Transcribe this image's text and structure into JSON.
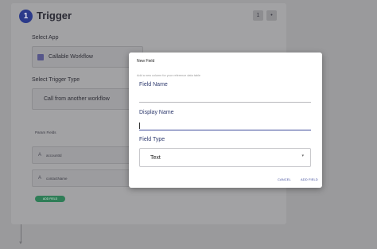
{
  "background": {
    "step_number": "1",
    "title": "Trigger",
    "mini_buttons": [
      "1",
      "•"
    ],
    "select_app_label": "Select App",
    "app_value": "Callable Workflow",
    "select_trigger_label": "Select Trigger Type",
    "trigger_value": "Call from another workflow",
    "param_fields_label": "Param Fields",
    "params": [
      {
        "icon": "A",
        "name": "accountId"
      },
      {
        "icon": "A",
        "name": "contactName"
      }
    ],
    "add_field_label": "ADD FIELD"
  },
  "modal": {
    "title": "New Field",
    "subtitle": "Add a new column for your reference data table",
    "field_name_label": "Field Name",
    "field_name_value": "",
    "display_name_label": "Display Name",
    "display_name_value": "",
    "field_type_label": "Field Type",
    "field_type_value": "Text",
    "cancel_label": "CANCEL",
    "add_field_label": "ADD FIELD"
  },
  "colors": {
    "accent": "#3d4a9a",
    "add_button": "#2f7d57"
  }
}
